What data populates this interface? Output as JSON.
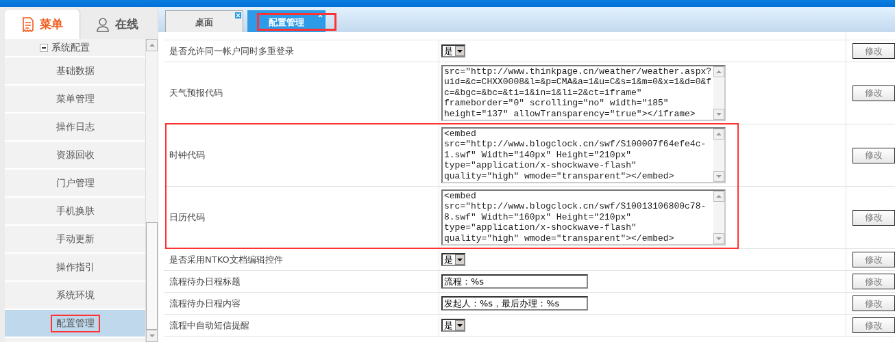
{
  "side_tabs": [
    {
      "label": "菜单",
      "kind": "menu",
      "selected": true
    },
    {
      "label": "在线",
      "kind": "online",
      "selected": false
    }
  ],
  "tree": {
    "label": "系统配置",
    "expanded": true,
    "children": [
      {
        "label": "基础数据",
        "selected": false,
        "annotated": false
      },
      {
        "label": "菜单管理",
        "selected": false,
        "annotated": false
      },
      {
        "label": "操作日志",
        "selected": false,
        "annotated": false
      },
      {
        "label": "资源回收",
        "selected": false,
        "annotated": false
      },
      {
        "label": "门户管理",
        "selected": false,
        "annotated": false
      },
      {
        "label": "手机换肤",
        "selected": false,
        "annotated": false
      },
      {
        "label": "手动更新",
        "selected": false,
        "annotated": false
      },
      {
        "label": "操作指引",
        "selected": false,
        "annotated": false
      },
      {
        "label": "系统环境",
        "selected": false,
        "annotated": false
      },
      {
        "label": "配置管理",
        "selected": true,
        "annotated": true
      }
    ]
  },
  "tabs": [
    {
      "label": "桌面",
      "selected": false,
      "annotated": false
    },
    {
      "label": "配置管理",
      "selected": true,
      "annotated": true
    }
  ],
  "settings": [
    {
      "label": "是否允许同一帐户同时多重登录",
      "kind": "select",
      "value": "是",
      "button": "修改",
      "annotated": false
    },
    {
      "label": "天气预报代码",
      "kind": "textarea",
      "value": "src=\"http://www.thinkpage.cn/weather/weather.aspx?uid=&c=CHXX0008&l=&p=CMA&a=1&u=C&s=1&m=0&x=1&d=0&fc=&bgc=&bc=&ti=1&in=1&li=2&ct=iframe\" frameborder=\"0\" scrolling=\"no\" width=\"185\" height=\"137\" allowTransparency=\"true\"></iframe>",
      "button": "修改",
      "annotated": false
    },
    {
      "label": "时钟代码",
      "kind": "textarea",
      "value": "<embed src=\"http://www.blogclock.cn/swf/S100007f64efe4c-1.swf\" Width=\"140px\" Height=\"210px\" type=\"application/x-shockwave-flash\" quality=\"high\" wmode=\"transparent\"></embed>",
      "button": "修改",
      "annotated": true
    },
    {
      "label": "日历代码",
      "kind": "textarea",
      "value": "<embed src=\"http://www.blogclock.cn/swf/S10013106800c78-8.swf\" Width=\"160px\" Height=\"210px\" type=\"application/x-shockwave-flash\" quality=\"high\" wmode=\"transparent\"></embed>",
      "button": "修改",
      "annotated": true
    },
    {
      "label": "是否采用NTKO文档编辑控件",
      "kind": "select",
      "value": "是",
      "button": "修改",
      "annotated": false
    },
    {
      "label": "流程待办日程标题",
      "kind": "text",
      "value": "流程：%s",
      "button": "修改",
      "annotated": false
    },
    {
      "label": "流程待办日程内容",
      "kind": "text",
      "value": "发起人：%s，最后办理：%s",
      "button": "修改",
      "annotated": false
    },
    {
      "label": "流程中自动短信提醒",
      "kind": "select",
      "value": "是",
      "button": "修改",
      "annotated": false
    }
  ]
}
